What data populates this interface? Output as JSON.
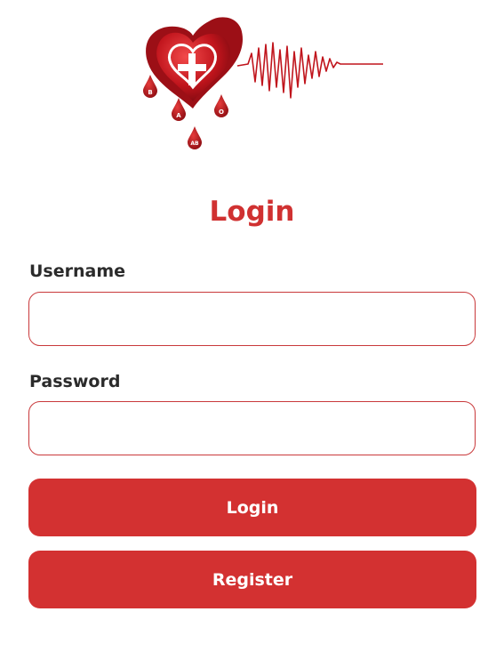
{
  "app": {
    "logo_icon": "blood-donation-heart-logo-icon",
    "logo_drop_labels": [
      "B",
      "A",
      "O",
      "AB"
    ]
  },
  "login_form": {
    "title": "Login",
    "username_label": "Username",
    "username_value": "",
    "password_label": "Password",
    "password_value": "",
    "login_button_label": "Login",
    "register_button_label": "Register"
  },
  "colors": {
    "accent": "#d33131",
    "field_border": "#c9393b",
    "label_text": "#2b2b2b",
    "background": "#ffffff"
  }
}
